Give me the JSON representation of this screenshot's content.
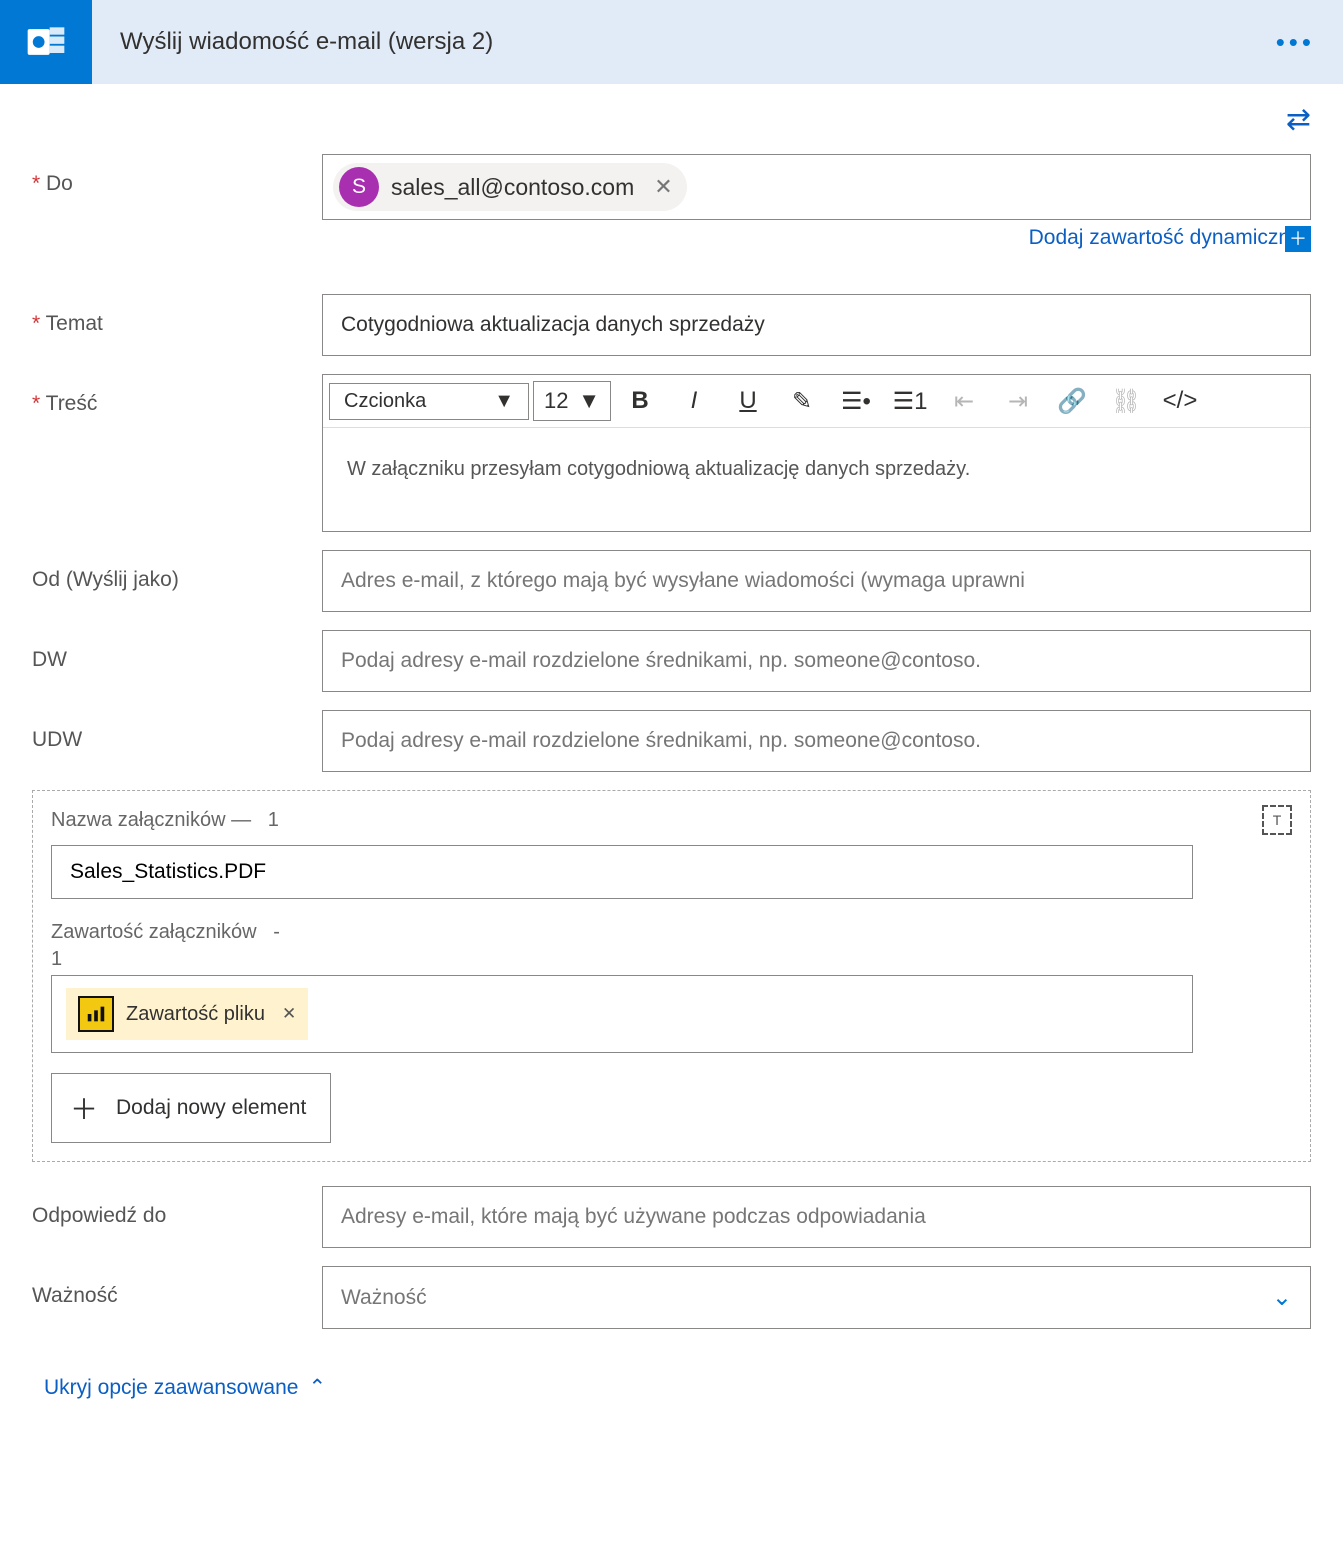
{
  "header": {
    "title": "Wyślij wiadomość e-mail (wersja 2)"
  },
  "labels": {
    "to": "Do",
    "subject": "Temat",
    "body": "Treść",
    "from": "Od (Wyślij jako)",
    "cc": "DW",
    "bcc": "UDW",
    "reply_to": "Odpowiedź do",
    "importance": "Ważność"
  },
  "values": {
    "to_chip": "sales_all@contoso.com",
    "to_chip_initial": "S",
    "subject": "Cotygodniowa aktualizacja danych sprzedaży",
    "body": "W załączniku przesyłam cotygodniową aktualizację danych sprzedaży.",
    "attachment_name": "Sales_Statistics.PDF",
    "file_token": "Zawartość pliku"
  },
  "placeholders": {
    "from": "Adres e-mail, z którego mają być wysyłane wiadomości (wymaga uprawni",
    "cc": "Podaj adresy e-mail rozdzielone średnikami, np. someone@contoso.",
    "bcc": "Podaj adresy e-mail rozdzielone średnikami, np. someone@contoso.",
    "reply_to": "Adresy e-mail, które mają być używane podczas odpowiadania",
    "importance": "Ważność"
  },
  "rte": {
    "font_label": "Czcionka",
    "size": "12"
  },
  "dynamic_link": "Dodaj zawartość dynamiczną",
  "attachments": {
    "name_label": "Nazwa załączników —",
    "name_count": "1",
    "content_label": "Zawartość załączników",
    "content_dash": "-",
    "content_count": "1",
    "add_new": "Dodaj nowy element"
  },
  "hide_options": "Ukryj opcje zaawansowane"
}
